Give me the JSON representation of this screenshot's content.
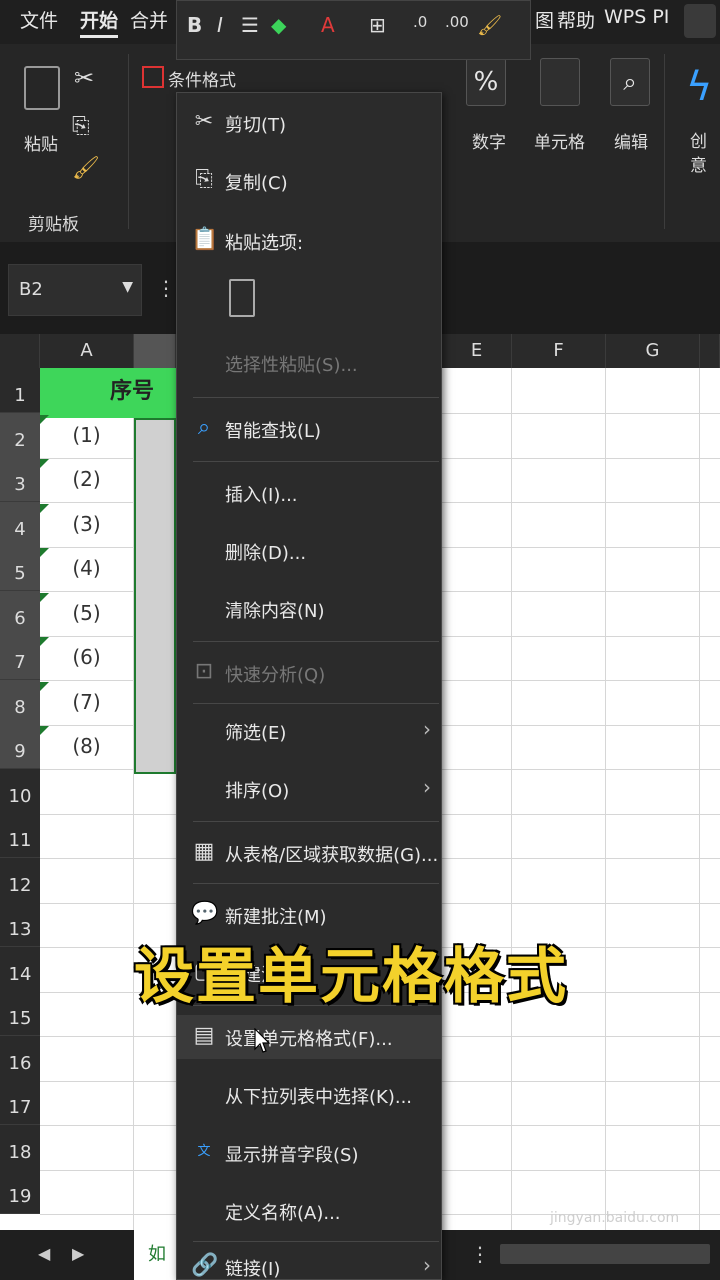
{
  "menubar": {
    "tabs": [
      "文件",
      "开始",
      "合并",
      "图",
      "帮助",
      "WPS PI"
    ],
    "active": "开始"
  },
  "ribbon": {
    "paste_label": "粘贴",
    "clipboard_label": "剪贴板",
    "conditional_format_label": "条件格式",
    "number_label": "数字",
    "cells_label": "单元格",
    "edit_label": "编辑",
    "create_label": "创意"
  },
  "namebox": {
    "value": "B2"
  },
  "columns": [
    "A",
    "E",
    "F",
    "G"
  ],
  "rows": [
    "1",
    "2",
    "3",
    "4",
    "5",
    "6",
    "7",
    "8",
    "9",
    "10",
    "11",
    "12",
    "13",
    "14",
    "15",
    "16",
    "17",
    "18",
    "19"
  ],
  "header_cell": "序号",
  "cells_A": [
    "(1)",
    "(2)",
    "(3)",
    "(4)",
    "(5)",
    "(6)",
    "(7)",
    "(8)"
  ],
  "sheet_tab": "如何",
  "menu": {
    "cut": "剪切(T)",
    "copy": "复制(C)",
    "paste_options": "粘贴选项:",
    "paste_special": "选择性粘贴(S)...",
    "smart_lookup": "智能查找(L)",
    "insert": "插入(I)...",
    "delete": "删除(D)...",
    "clear_contents": "清除内容(N)",
    "quick_analysis": "快速分析(Q)",
    "filter": "筛选(E)",
    "sort": "排序(O)",
    "get_data": "从表格/区域获取数据(G)...",
    "new_comment": "新建批注(M)",
    "new_note": "新建注释",
    "format_cells": "设置单元格格式(F)...",
    "pick_list": "从下拉列表中选择(K)...",
    "phonetic": "显示拼音字段(S)",
    "define_name": "定义名称(A)...",
    "link": "链接(I)"
  },
  "caption": "设置单元格格式",
  "watermark": "jingyan.baidu.com"
}
